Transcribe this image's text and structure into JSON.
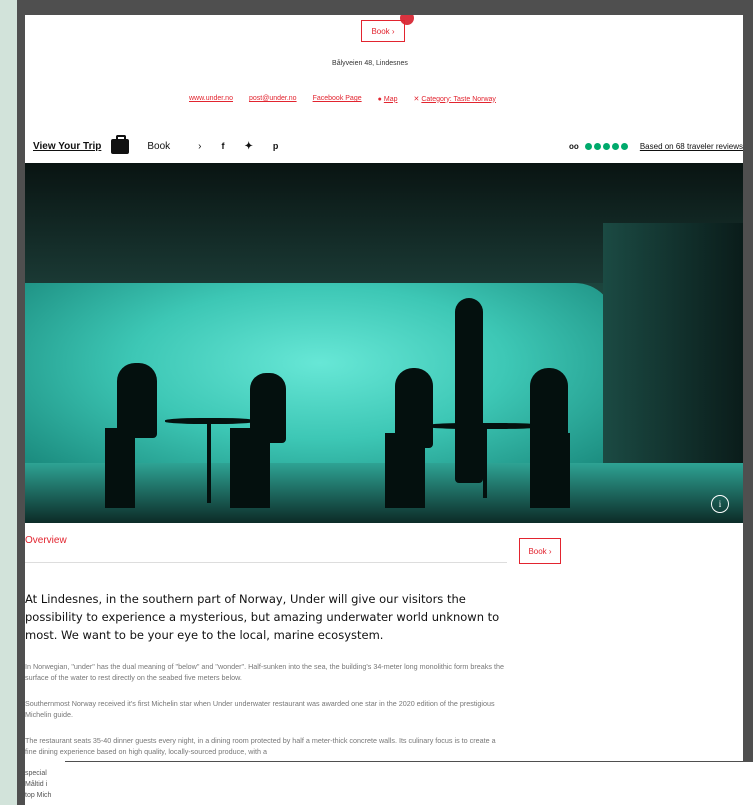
{
  "header": {
    "book_label": "Book ›",
    "address": "Bålyveien 48, Lindesnes",
    "links": [
      {
        "label": "www.under.no",
        "icon": ""
      },
      {
        "label": "post@under.no",
        "icon": ""
      },
      {
        "label": "Facebook Page",
        "icon": ""
      },
      {
        "label": "Map",
        "icon": "map-pin-icon"
      },
      {
        "label": "Category: Taste Norway",
        "icon": "cutlery-icon"
      }
    ]
  },
  "toolbar": {
    "view_trip": "View Your Trip",
    "book": "Book",
    "chevron": "›",
    "facebook": "f",
    "twitter": "🐦",
    "pinterest": "p",
    "rating_brand": "oo",
    "rating_value": 5,
    "reviews": "Based on 68 traveler reviews"
  },
  "overview": {
    "title": "Overview",
    "book_label": "Book ›",
    "lead": "At Lindesnes, in the southern part of Norway, Under will give our visitors the possibility to experience a mysterious, but amazing underwater world unknown to most. We want to be your eye to the local, marine ecosystem.",
    "paragraphs": [
      "In Norwegian, \"under\" has the dual meaning of \"below\" and \"wonder\". Half-sunken into the sea, the building's 34-meter long monolithic form breaks the surface of the water to rest directly on the seabed five meters below.",
      "Southernmost Norway received it's first Michelin star when Under underwater restaurant was awarded one star in the 2020 edition of the prestigious Michelin guide.",
      "The restaurant seats 35-40 dinner guests every night, in a dining room protected by half a meter-thick concrete walls. Its culinary focus is to create a fine dining experience based on high quality, locally-sourced produce, with a"
    ],
    "fragments": [
      "special",
      "Måltid i",
      "top Mich"
    ]
  },
  "colors": {
    "accent": "#e2242f",
    "rating_green": "#00aa6c",
    "frame": "#4f4f4f",
    "backdrop": "#d2e3da"
  }
}
